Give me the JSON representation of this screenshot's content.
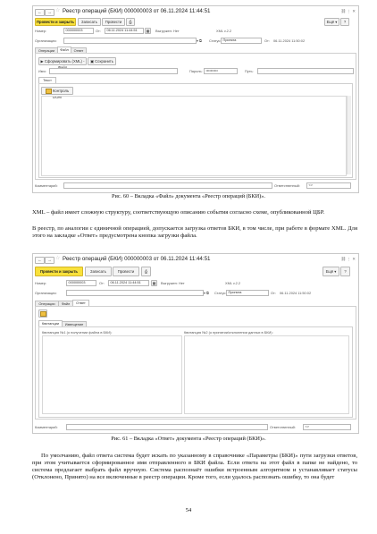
{
  "screenshots": [
    {
      "nav": {
        "back": "←",
        "forward": "→"
      },
      "title": "Реестр операций (БКИ) 000000003 от 06.11.2024 11:44:51",
      "header_icons": "⛓ ⋮ ✕",
      "toolbar": {
        "post_close": "Провести и закрыть",
        "save": "Записать",
        "post": "Провести",
        "more": "Ещё ▾",
        "help": "?"
      },
      "fields": {
        "number_label": "Номер:",
        "number": "000000003",
        "date_label": "От:",
        "date": "06.11.2024 11:44:51",
        "uploaded_label": "Выгружен: Нет",
        "xml_version": "XML v.2.2",
        "org_label": "Организация:",
        "status_label": "Статус:",
        "status": "Принята",
        "status_date_label": "От:",
        "status_date": "06.11.2024 11:50:02"
      },
      "tabs": [
        "Операции",
        "Файл",
        "Ответ"
      ],
      "active_tab": "Файл",
      "file_tab": {
        "generate_btn": "Сформировать (XML) - Файл",
        "save_btn": "Сохранить",
        "name_label": "Имя:",
        "password_label": "Пароль:",
        "password": "••••••••••",
        "path_label": "Путь:",
        "text_tab": "Текст",
        "dom_btn": "Контроль DOM"
      },
      "comment_label": "Комментарий:",
      "responsible_label": "Ответственный:",
      "responsible": "<>"
    },
    {
      "nav": {
        "back": "←",
        "forward": "→"
      },
      "title": "Реестр операций (БКИ) 000000003 от 06.11.2024 11:44:51",
      "header_icons": "⛓ ⋮ ✕",
      "toolbar": {
        "post_close": "Провести и закрыть",
        "save": "Записать",
        "post": "Провести",
        "more": "Ещё ▾",
        "help": "?"
      },
      "fields": {
        "number_label": "Номер:",
        "number": "000000003",
        "date_label": "От:",
        "date": "06.11.2024 11:44:51",
        "uploaded_label": "Выгружен: Нет",
        "xml_version": "XML v.2.2",
        "org_label": "Организация:",
        "status_label": "Статус:",
        "status": "Принята",
        "status_date_label": "От:",
        "status_date": "06.11.2024 11:50:02"
      },
      "tabs": [
        "Операции",
        "Файл",
        "Ответ"
      ],
      "active_tab": "Ответ",
      "answer_tab": {
        "subtabs": [
          "Квитанции",
          "Извещение"
        ],
        "receipt1": "Квитанция №1 (о получении файла в БКИ):",
        "receipt2": "Квитанция №2 (о принятии/отклонении данных в БКИ):"
      },
      "comment_label": "Комментарий:",
      "responsible_label": "Ответственный:",
      "responsible": "<>"
    }
  ],
  "captions": {
    "fig60": "Рис. 60 – Вкладка «Файл» документа «Реестр операций (БКИ)».",
    "fig61": "Рис. 61 – Вкладка «Ответ» документа «Реестр операций (БКИ)»."
  },
  "paragraphs": {
    "p1": "XML – файл имеет сложную структуру, соответствующую описанию события согласно схеме, опубликованной ЦБР.",
    "p2": "В реестр, по аналогии с единичной операцией, допускается загрузка ответов БКИ, в том числе, при работе в формате XML. Для этого на закладке «Ответ» предусмотрена кнопка загрузки файла.",
    "p3": "По умолчанию, файл ответа система будет искать по указанному в справочнике «Параметры (БКИ)» пути загрузки ответов, при этом учитывается сформированное имя отправленного в БКИ файла. Если ответа на этот файл в папке не найдено, то система предлагает выбрать файл вручную. Система распознаёт ошибки встроенным алгоритмом и устанавливает статусы (Отклонено, Принято) на все включенные в реестр операции. Кроме того, если удалось распознать ошибку, то она будет"
  },
  "page_number": "54"
}
